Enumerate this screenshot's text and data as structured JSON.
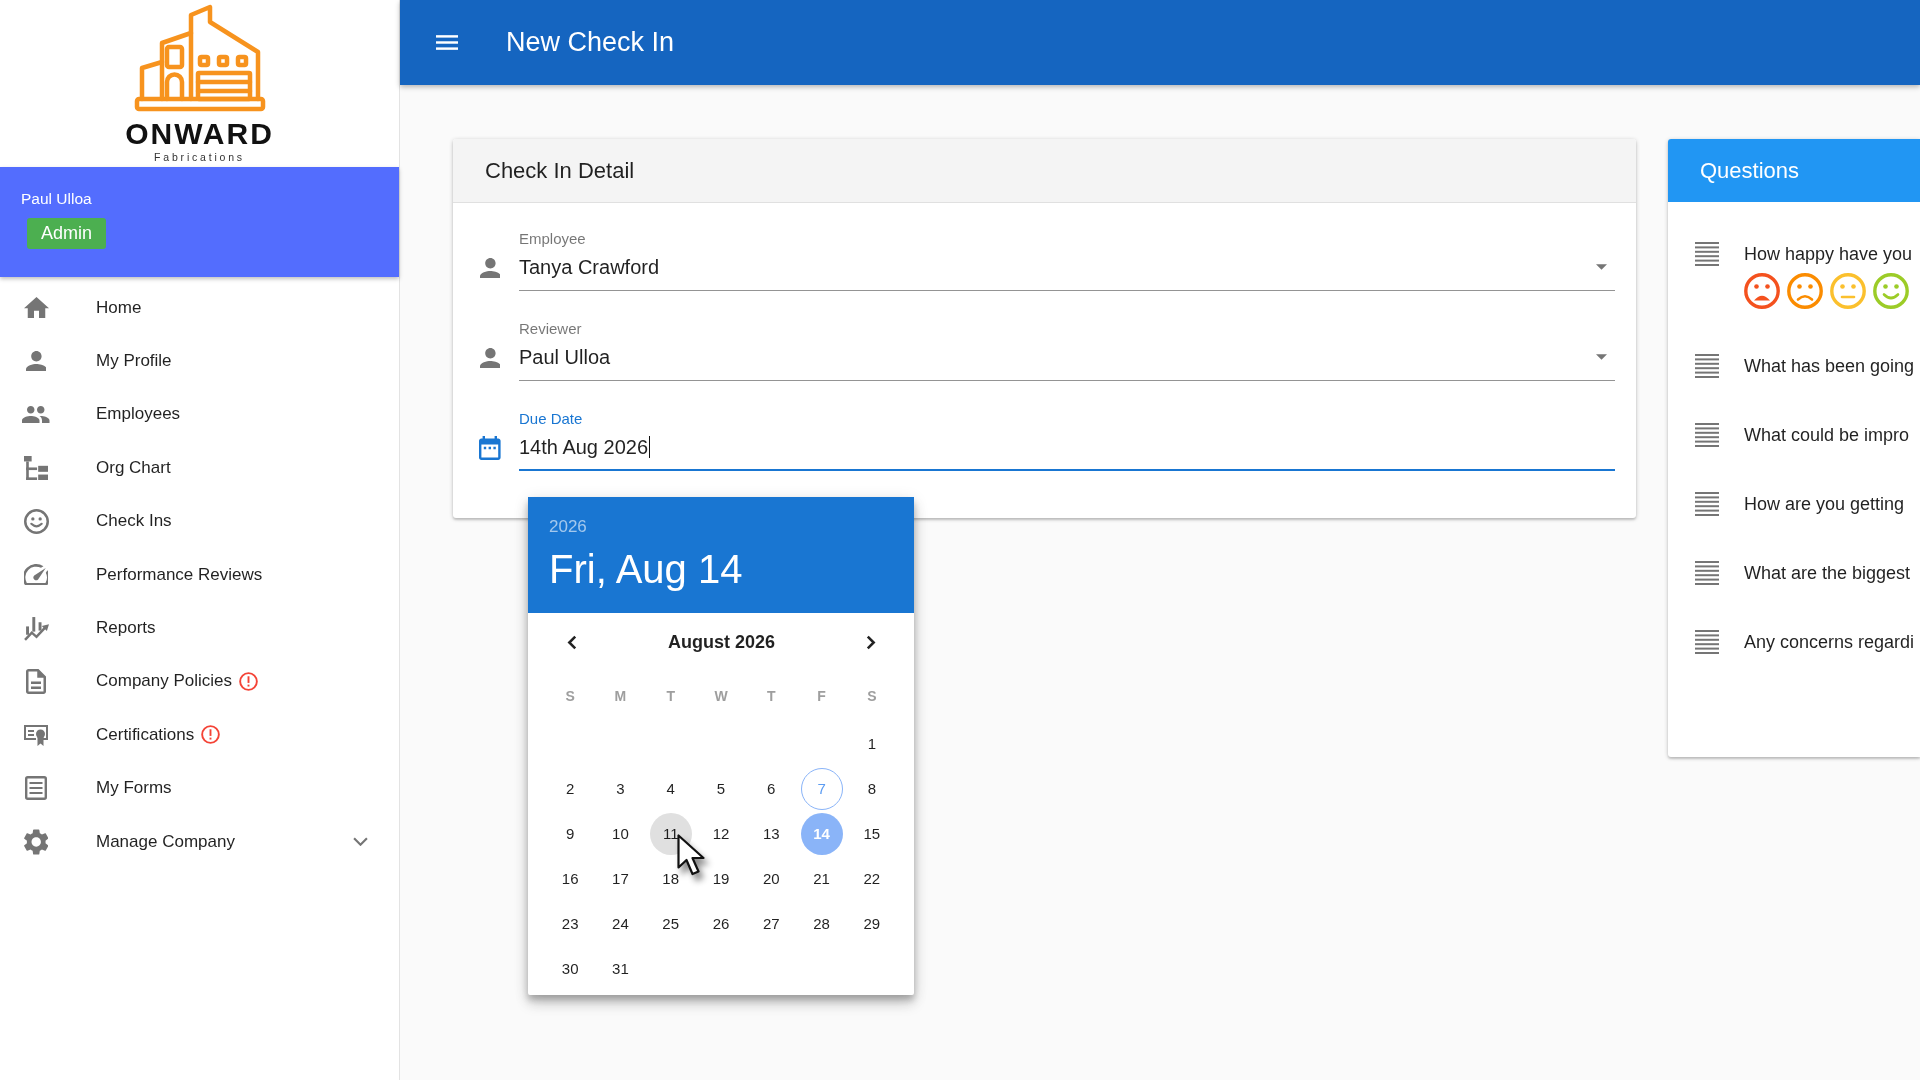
{
  "sidebar": {
    "logo": {
      "wordmark": "ONWARD",
      "tagline": "Fabrications"
    },
    "user": {
      "name": "Paul Ulloa",
      "role": "Admin"
    },
    "items": [
      {
        "label": "Home",
        "kind": "link",
        "selected": false,
        "alert": false
      },
      {
        "label": "My Profile",
        "kind": "link",
        "selected": false,
        "alert": false
      },
      {
        "label": "Employees",
        "kind": "link",
        "selected": false,
        "alert": false
      },
      {
        "label": "Org Chart",
        "kind": "link",
        "selected": false,
        "alert": false
      },
      {
        "label": "Check Ins",
        "kind": "link",
        "selected": false,
        "alert": false
      },
      {
        "label": "Performance Reviews",
        "kind": "link",
        "selected": false,
        "alert": false
      },
      {
        "label": "Reports",
        "kind": "link",
        "selected": false,
        "alert": false
      },
      {
        "label": "Company Policies",
        "kind": "link",
        "selected": false,
        "alert": true
      },
      {
        "label": "Certifications",
        "kind": "link",
        "selected": false,
        "alert": true
      },
      {
        "label": "My Forms",
        "kind": "link",
        "selected": false,
        "alert": false
      },
      {
        "label": "Manage Company",
        "kind": "group",
        "selected": false,
        "alert": false,
        "expanded": false
      }
    ]
  },
  "app_bar": {
    "title": "New Check In"
  },
  "form": {
    "title": "Check In Detail",
    "fields": [
      {
        "kind": "select",
        "label": "Employee",
        "value": "Tanya Crawford",
        "focused": false
      },
      {
        "kind": "select",
        "label": "Reviewer",
        "value": "Paul Ulloa",
        "focused": false
      },
      {
        "kind": "date",
        "label": "Due Date",
        "value": "14th Aug 2026",
        "focused": true,
        "calendar": {
          "year": "2026",
          "date": "Fri, Aug 14",
          "month": "August 2026",
          "weekdays": [
            "S",
            "M",
            "T",
            "W",
            "T",
            "F",
            "S"
          ],
          "weeks": [
            {
              "days": [
                {
                  "label": "1",
                  "selected": false,
                  "today": false,
                  "hovered": false
                }
              ]
            },
            {
              "days": [
                {
                  "label": "2",
                  "selected": false,
                  "today": false,
                  "hovered": false
                },
                {
                  "label": "3",
                  "selected": false,
                  "today": false,
                  "hovered": false
                },
                {
                  "label": "4",
                  "selected": false,
                  "today": false,
                  "hovered": false
                },
                {
                  "label": "5",
                  "selected": false,
                  "today": false,
                  "hovered": false
                },
                {
                  "label": "6",
                  "selected": false,
                  "today": false,
                  "hovered": false
                },
                {
                  "label": "7",
                  "selected": false,
                  "today": true,
                  "hovered": false
                },
                {
                  "label": "8",
                  "selected": false,
                  "today": false,
                  "hovered": false
                }
              ]
            },
            {
              "days": [
                {
                  "label": "9",
                  "selected": false,
                  "today": false,
                  "hovered": false
                },
                {
                  "label": "10",
                  "selected": false,
                  "today": false,
                  "hovered": false
                },
                {
                  "label": "11",
                  "selected": false,
                  "today": false,
                  "hovered": true
                },
                {
                  "label": "12",
                  "selected": false,
                  "today": false,
                  "hovered": false
                },
                {
                  "label": "13",
                  "selected": false,
                  "today": false,
                  "hovered": false
                },
                {
                  "label": "14",
                  "selected": true,
                  "today": false,
                  "hovered": false
                },
                {
                  "label": "15",
                  "selected": false,
                  "today": false,
                  "hovered": false
                }
              ]
            },
            {
              "days": [
                {
                  "label": "16",
                  "selected": false,
                  "today": false,
                  "hovered": false
                },
                {
                  "label": "17",
                  "selected": false,
                  "today": false,
                  "hovered": false
                },
                {
                  "label": "18",
                  "selected": false,
                  "today": false,
                  "hovered": false
                },
                {
                  "label": "19",
                  "selected": false,
                  "today": false,
                  "hovered": false
                },
                {
                  "label": "20",
                  "selected": false,
                  "today": false,
                  "hovered": false
                },
                {
                  "label": "21",
                  "selected": false,
                  "today": false,
                  "hovered": false
                },
                {
                  "label": "22",
                  "selected": false,
                  "today": false,
                  "hovered": false
                }
              ]
            },
            {
              "days": [
                {
                  "label": "23",
                  "selected": false,
                  "today": false,
                  "hovered": false
                },
                {
                  "label": "24",
                  "selected": false,
                  "today": false,
                  "hovered": false
                },
                {
                  "label": "25",
                  "selected": false,
                  "today": false,
                  "hovered": false
                },
                {
                  "label": "26",
                  "selected": false,
                  "today": false,
                  "hovered": false
                },
                {
                  "label": "27",
                  "selected": false,
                  "today": false,
                  "hovered": false
                },
                {
                  "label": "28",
                  "selected": false,
                  "today": false,
                  "hovered": false
                },
                {
                  "label": "29",
                  "selected": false,
                  "today": false,
                  "hovered": false
                }
              ]
            },
            {
              "days": [
                {
                  "label": "30",
                  "selected": false,
                  "today": false,
                  "hovered": false
                },
                {
                  "label": "31",
                  "selected": false,
                  "today": false,
                  "hovered": false
                }
              ]
            }
          ]
        }
      }
    ]
  },
  "questions": {
    "title": "Questions",
    "items": [
      {
        "text": "How happy have you",
        "rating": [
          {
            "kind": "very_sad",
            "color": "#f4511e"
          },
          {
            "kind": "sad",
            "color": "#fb8c00"
          },
          {
            "kind": "neutral",
            "color": "#fbc02d"
          },
          {
            "kind": "happy",
            "color": "#9ccc27"
          }
        ]
      },
      {
        "text": "What has been going"
      },
      {
        "text": "What could be impro"
      },
      {
        "text": "How are you getting"
      },
      {
        "text": "What are the biggest"
      },
      {
        "text": "Any concerns regardi"
      }
    ]
  }
}
